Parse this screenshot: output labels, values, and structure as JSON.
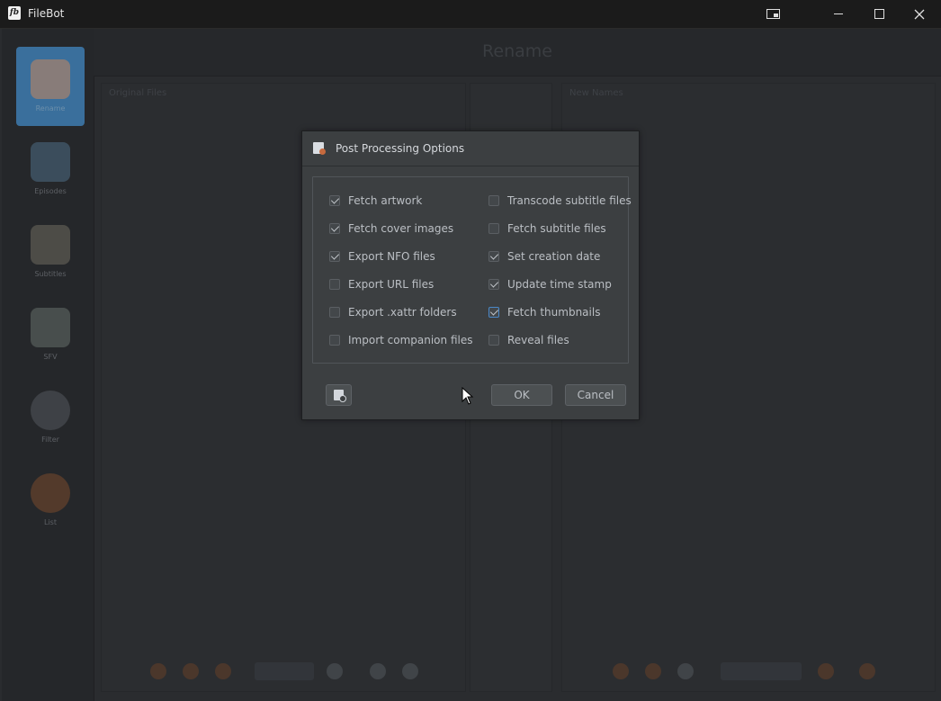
{
  "window": {
    "app_icon": "fb",
    "title": "FileBot",
    "controls": [
      "picture-in-picture-icon",
      "minimize-icon",
      "maximize-icon",
      "close-icon"
    ]
  },
  "background": {
    "header_title": "Rename",
    "left_panel_title": "Original Files",
    "right_panel_title": "New Names",
    "sidebar": [
      {
        "label": "Rename",
        "icon": "rename-icon",
        "active": true
      },
      {
        "label": "Episodes",
        "icon": "episodes-icon",
        "active": false
      },
      {
        "label": "Subtitles",
        "icon": "subtitles-icon",
        "active": false
      },
      {
        "label": "SFV",
        "icon": "sfv-icon",
        "active": false
      },
      {
        "label": "Filter",
        "icon": "filter-icon",
        "active": false
      },
      {
        "label": "List",
        "icon": "list-icon",
        "active": false
      }
    ]
  },
  "dialog": {
    "title": "Post Processing Options",
    "options_left": [
      {
        "label": "Fetch artwork",
        "checked": true
      },
      {
        "label": "Fetch cover images",
        "checked": true
      },
      {
        "label": "Export NFO files",
        "checked": true
      },
      {
        "label": "Export URL files",
        "checked": false
      },
      {
        "label": "Export .xattr folders",
        "checked": false
      },
      {
        "label": "Import companion files",
        "checked": false
      }
    ],
    "options_right": [
      {
        "label": "Transcode subtitle files",
        "checked": false
      },
      {
        "label": "Fetch subtitle files",
        "checked": false
      },
      {
        "label": "Set creation date",
        "checked": true
      },
      {
        "label": "Update time stamp",
        "checked": true
      },
      {
        "label": "Fetch thumbnails",
        "checked": true
      },
      {
        "label": "Reveal files",
        "checked": false
      }
    ],
    "ok_label": "OK",
    "cancel_label": "Cancel",
    "script_icon": "script-icon"
  }
}
